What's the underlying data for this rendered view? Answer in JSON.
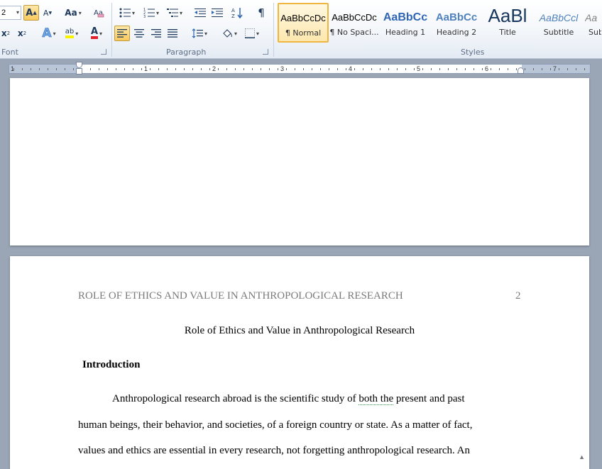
{
  "ribbon": {
    "font_group": {
      "label": "Font",
      "size_value": "2",
      "grow_font": "A",
      "shrink_font": "A",
      "change_case": "Aa",
      "subscript": "x",
      "superscript": "x",
      "sub_mark": "2",
      "sup_mark": "2",
      "highlight": "ab",
      "font_color": "A"
    },
    "paragraph_group": {
      "label": "Paragraph",
      "show_marks": "¶"
    },
    "styles_group": {
      "label": "Styles",
      "items": [
        {
          "sample": "AaBbCcDc",
          "name": "¶ Normal"
        },
        {
          "sample": "AaBbCcDc",
          "name": "¶ No Spaci..."
        },
        {
          "sample": "AaBbCc",
          "name": "Heading 1"
        },
        {
          "sample": "AaBbCc",
          "name": "Heading 2"
        },
        {
          "sample": "AaBl",
          "name": "Title"
        },
        {
          "sample": "AaBbCcl",
          "name": "Subtitle"
        },
        {
          "sample": "Aa",
          "name": "Sub"
        }
      ]
    }
  },
  "ruler": {
    "numbers": [
      "1",
      "1",
      "2",
      "3",
      "4",
      "5",
      "6",
      "7"
    ]
  },
  "document": {
    "running_head": "ROLE OF ETHICS AND VALUE IN ANTHROPOLOGICAL RESEARCH",
    "page_number": "2",
    "title": "Role of Ethics and Value in Anthropological Research",
    "heading": "Introduction",
    "line1_pre": "Anthropological research abroad is the scientific study of ",
    "line1_flag": "both the",
    "line1_post": " present and past",
    "line2": "human beings, their behavior, and societies, of a foreign country or state. As a matter of fact,",
    "line3": "values and ethics are essential in every research, not forgetting anthropological research.  An"
  },
  "colors": {
    "selected_style_border": "#f0b53e",
    "heading_style": "#2e74b5",
    "workspace": "#9aa6b6",
    "ribbon_text": "#1e395b"
  }
}
